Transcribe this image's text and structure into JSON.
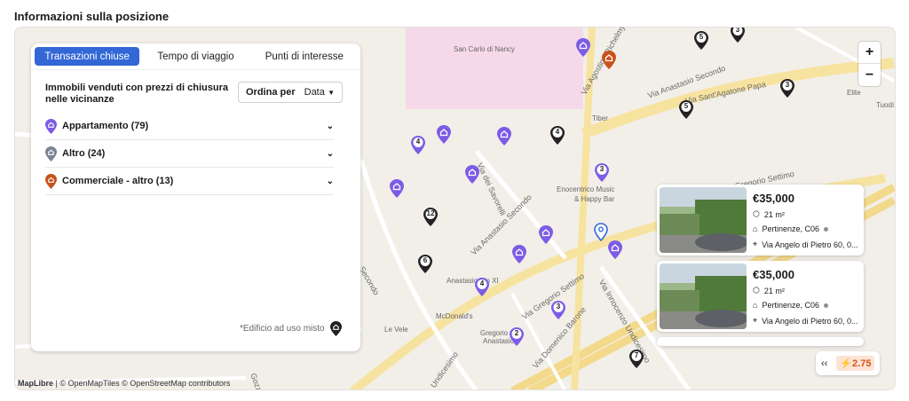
{
  "section_title": "Informazioni sulla posizione",
  "tabs": [
    {
      "label": "Transazioni chiuse",
      "active": true
    },
    {
      "label": "Tempo di viaggio",
      "active": false
    },
    {
      "label": "Punti di interesse",
      "active": false
    }
  ],
  "panel": {
    "title": "Immobili venduti con prezzi di chiusura nelle vicinanze",
    "sort_label": "Ordina per",
    "sort_value": "Data",
    "categories": [
      {
        "label": "Appartamento (79)",
        "color": "#7c5ce6"
      },
      {
        "label": "Altro (24)",
        "color": "#7a8596"
      },
      {
        "label": "Commerciale - altro (13)",
        "color": "#c8531d"
      }
    ],
    "mixed_note": "*Edificio ad uso misto"
  },
  "zoom": {
    "in": "+",
    "out": "−"
  },
  "map_labels": {
    "san_carlo": "San Carlo di Nancy",
    "tiber": "Tiber",
    "enocentrico": "Enocentrico Music",
    "happy_bar": "& Happy Bar",
    "anastasio_pio": "Anastasio Pio XI",
    "mcdonalds": "McDonald's",
    "gregorio": "Gregorio",
    "anastasio": "Anastasio",
    "le_vele": "Le Vele",
    "elite": "Elite",
    "tuodi": "Tuodì",
    "via_anastasio_secondo": "Via Anastasio Secondo",
    "via_sant_agatone": "Via Sant'Agatone Papa",
    "via_gregorio_settimo": "Via Gregorio Settimo",
    "via_savorelli": "Via dei Savorelli",
    "via_domenico_barone": "Via Domenico Barone",
    "via_innocenzo": "Via Innocenzo Undicesimo",
    "via_agostino": "Via Agostino Richelmy",
    "secondo": "Secondo",
    "undicesimo": "Undicesimo",
    "gozzadini": "Gozzadini"
  },
  "pin_numbers": [
    "5",
    "3",
    "3",
    "5",
    "4",
    "4",
    "3",
    "12",
    "6",
    "4",
    "3",
    "2",
    "7"
  ],
  "listings": [
    {
      "price": "€35,000",
      "area": "21 m²",
      "type": "Pertinenze, C06",
      "address": "Via Angelo di Pietro 60, 0..."
    },
    {
      "price": "€35,000",
      "area": "21 m²",
      "type": "Pertinenze, C06",
      "address": "Via Angelo di Pietro 60, 0..."
    }
  ],
  "collapse_icon": "‹‹",
  "boost_value": "2.75",
  "attribution": {
    "maplibre": "MapLibre",
    "rest": " | © OpenMapTiles © OpenStreetMap contributors"
  }
}
